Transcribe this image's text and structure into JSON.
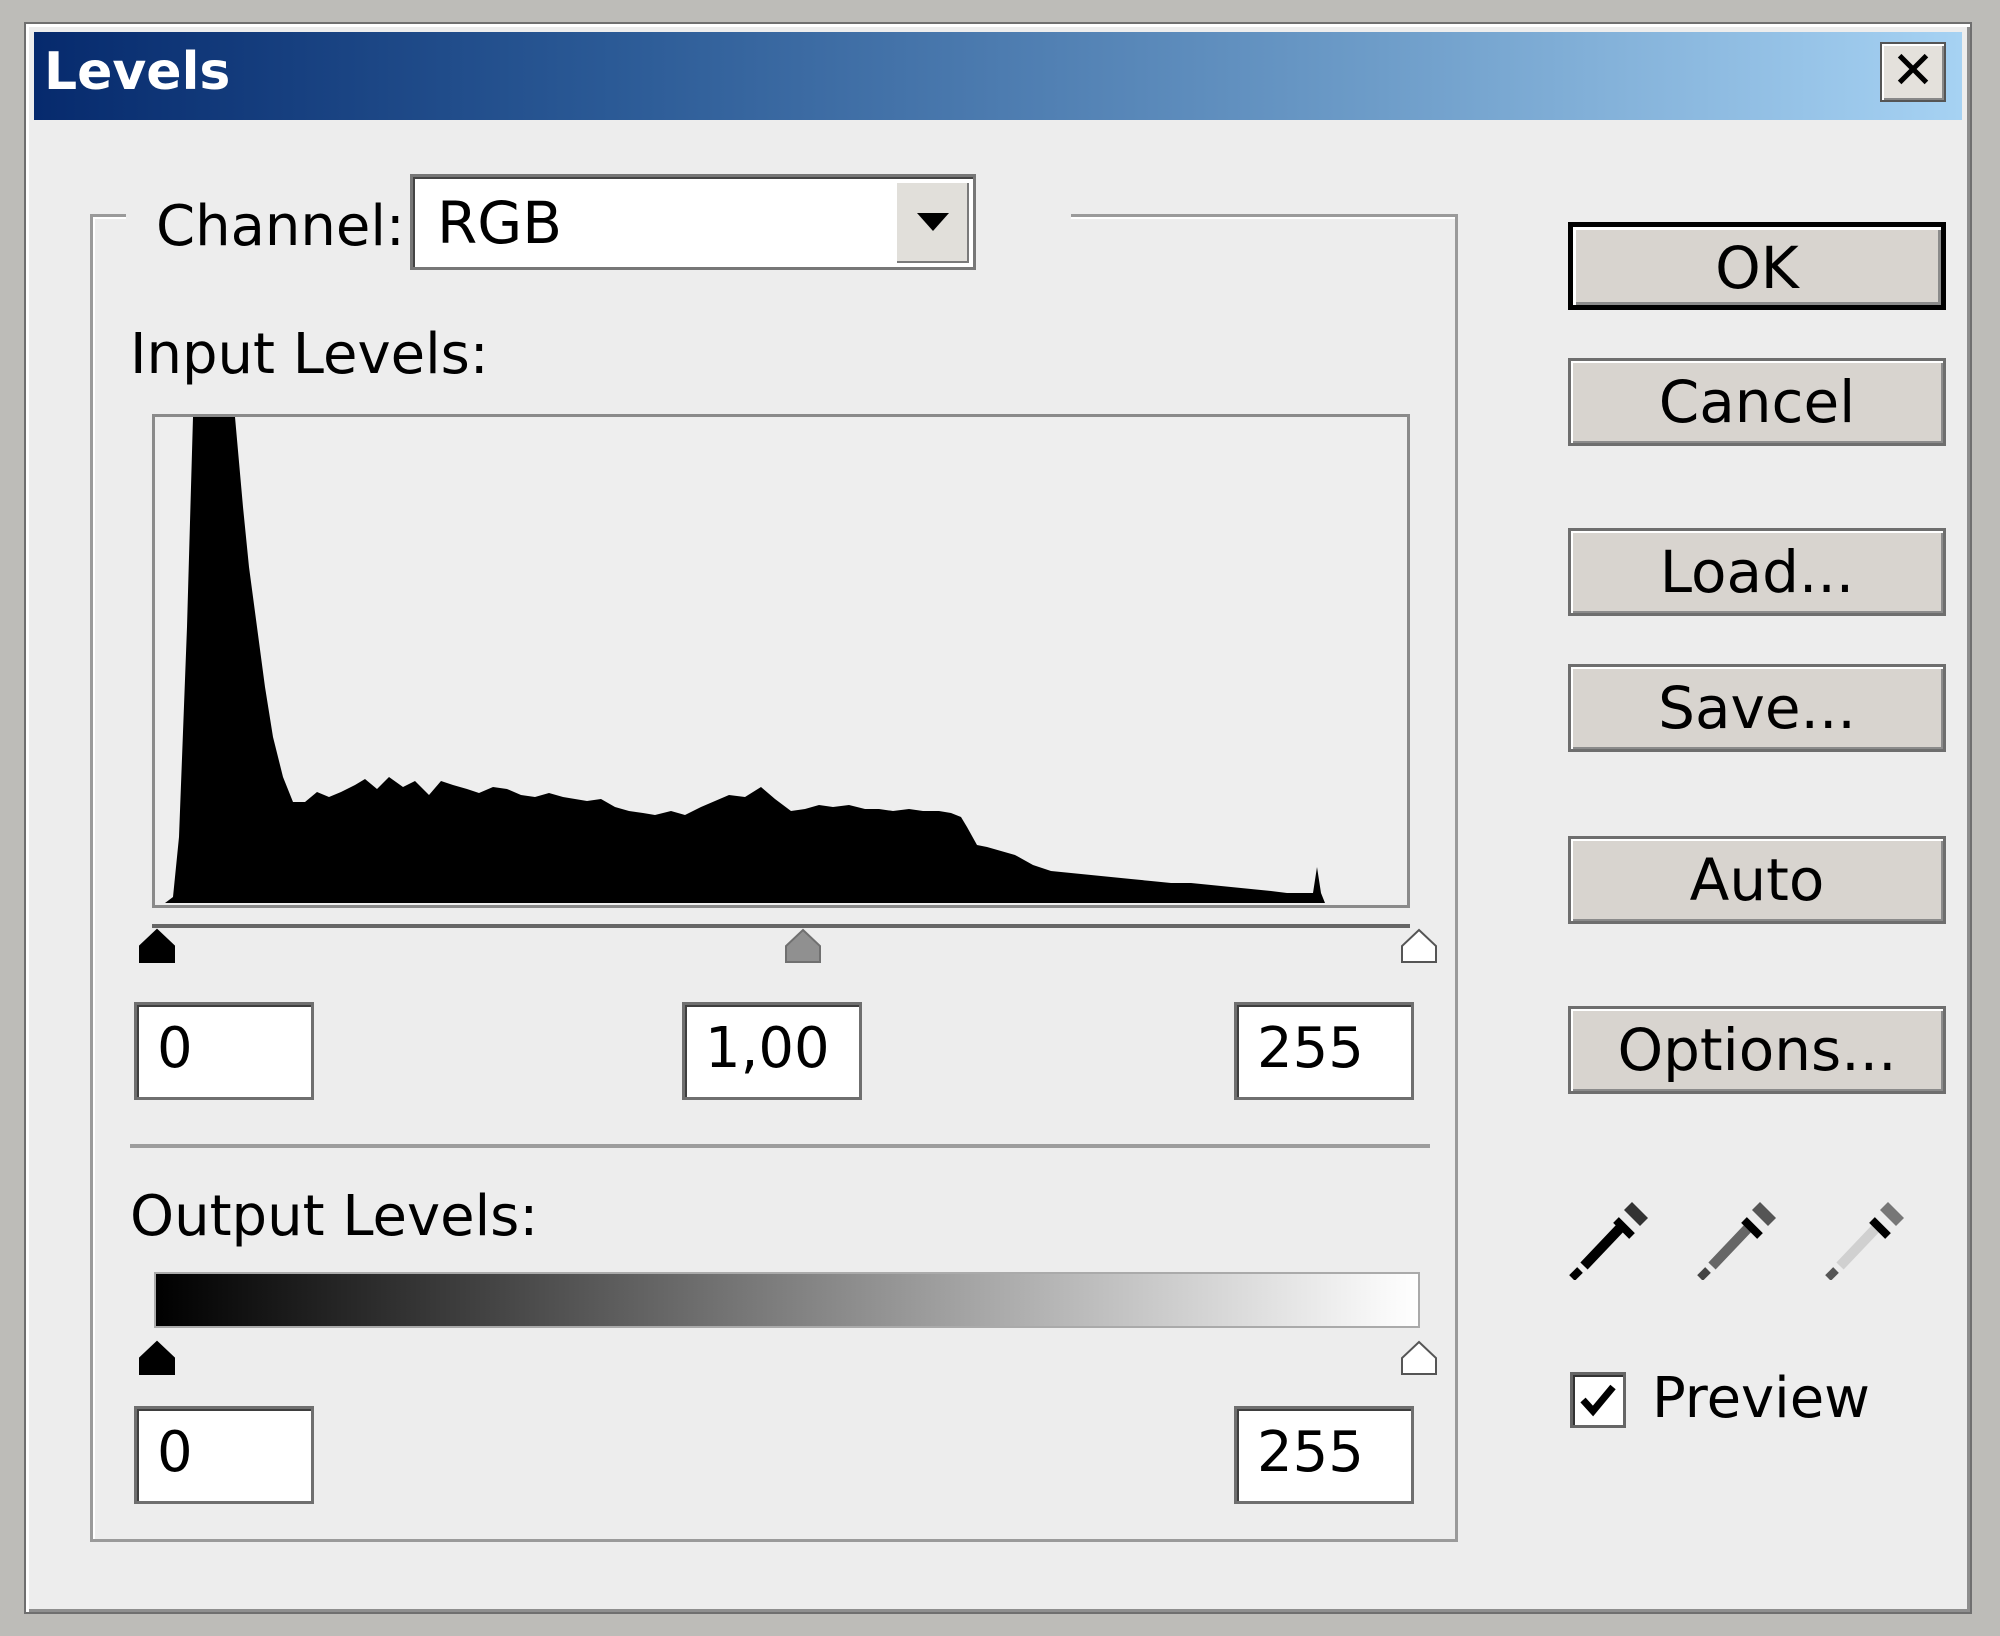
{
  "window": {
    "title": "Levels"
  },
  "channel": {
    "label": "Channel:",
    "value": "RGB"
  },
  "input_levels": {
    "label": "Input Levels:",
    "black": "0",
    "gamma": "1,00",
    "white": "255"
  },
  "output_levels": {
    "label": "Output Levels:",
    "black": "0",
    "white": "255"
  },
  "buttons": {
    "ok": "OK",
    "cancel": "Cancel",
    "load": "Load...",
    "save": "Save...",
    "auto": "Auto",
    "options": "Options..."
  },
  "preview": {
    "label": "Preview",
    "checked": true
  },
  "icons": {
    "close": "close-icon",
    "dropdown": "chevron-down-icon",
    "black_eyedropper": "eyedropper-black-icon",
    "gray_eyedropper": "eyedropper-gray-icon",
    "white_eyedropper": "eyedropper-white-icon"
  }
}
